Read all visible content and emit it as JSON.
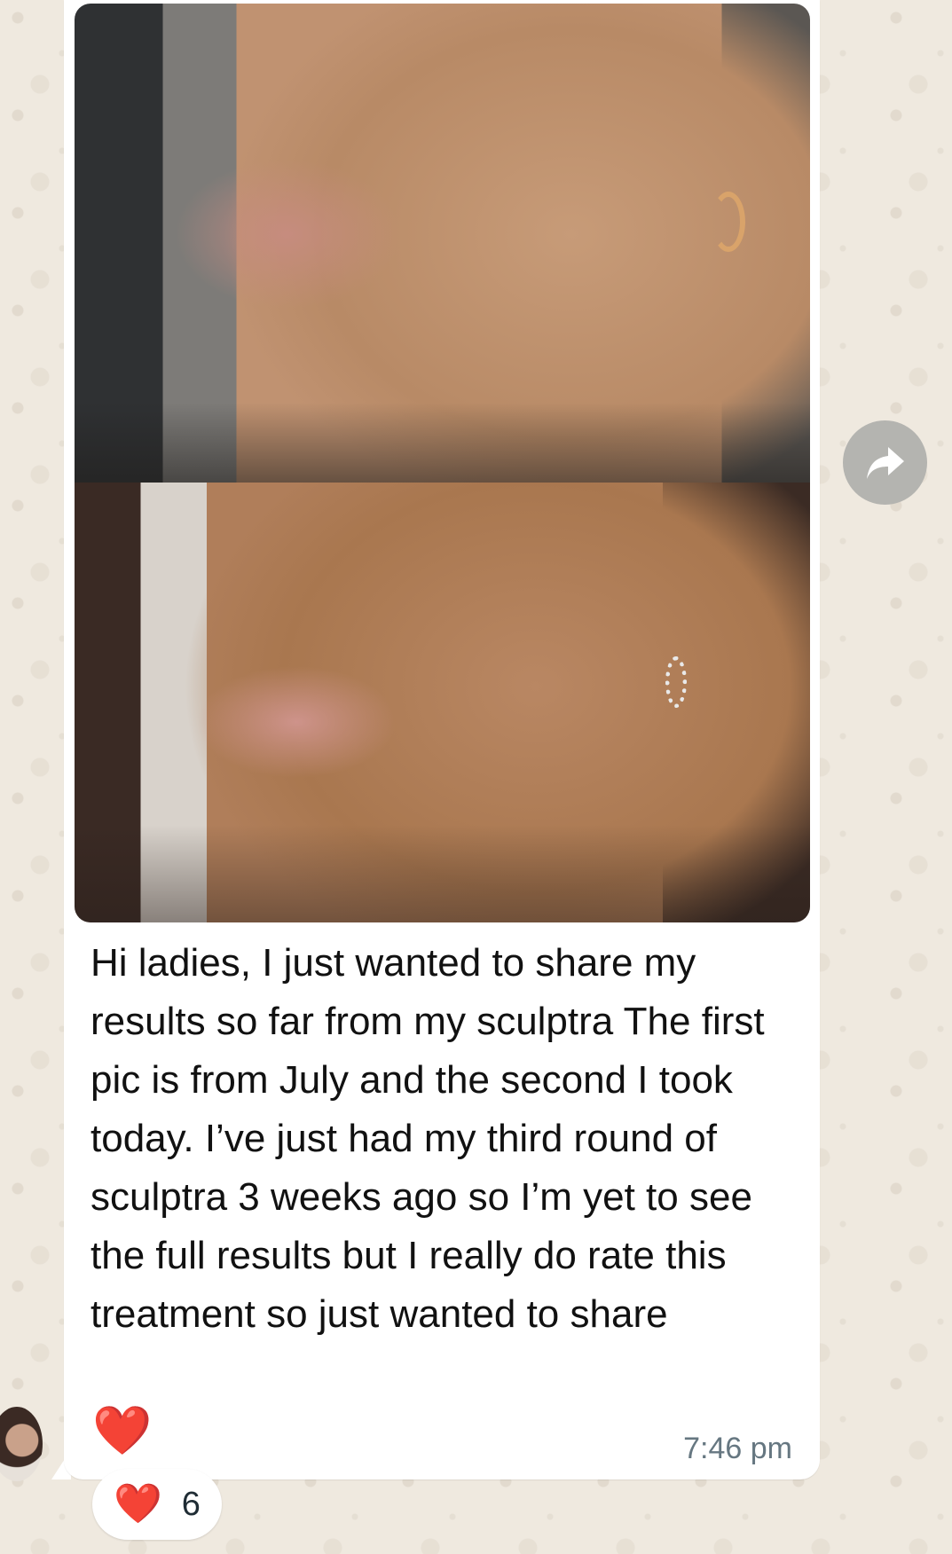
{
  "message": {
    "text": "Hi ladies, I just wanted to share my results so far from my sculptra The first pic is from July and the second I took today. I’ve just had my third round of sculptra 3 weeks ago so I’m yet to see the full results but I really do rate this treatment so just wanted to share",
    "emoji": "❤️",
    "time": "7:46 pm"
  },
  "reactions": {
    "emoji": "❤️",
    "count": "6"
  },
  "icons": {
    "forward": "forward-arrow-icon",
    "avatar": "sender-avatar"
  },
  "colors": {
    "bubble": "#ffffff",
    "wallpaper": "#efe9df",
    "timestamp": "#667781",
    "forward_button": "#b4b4b0",
    "heart": "#e53935"
  }
}
